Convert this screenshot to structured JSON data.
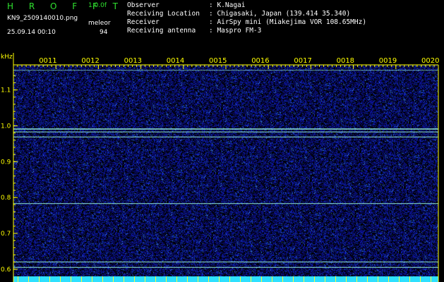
{
  "header": {
    "app_name": "H R O F F T",
    "version": "1.0.0f",
    "file_name": "KN9_2509140010.png",
    "program": "meleor",
    "datetime": "25.09.14 00:10",
    "number": "94"
  },
  "info": [
    {
      "label": "Observer",
      "value": ": K.Nagai"
    },
    {
      "label": "Receiving Location",
      "value": ": Chigasaki, Japan (139.414 35.340)"
    },
    {
      "label": "Receiver",
      "value": ": AirSpy mini (Miakejima VOR 108.65MHz)"
    },
    {
      "label": "Receiving antenna",
      "value": ": Maspro FM-3"
    }
  ],
  "plot": {
    "y_unit": "kHz",
    "y_ticks": [
      "1.1",
      "1.0",
      "0.9",
      "0.8",
      "0.7",
      "0.6"
    ],
    "x_ticks": [
      "0011",
      "0012",
      "0013",
      "0014",
      "0015",
      "0016",
      "0017",
      "0018",
      "0019",
      "0020"
    ],
    "ylim": [
      0.58,
      1.17
    ],
    "colors": {
      "background": "#000000",
      "axis": "#ffff00",
      "noise": "#1e2a9a",
      "line": "#9fffe0",
      "bottom_band": "#2ee0ff"
    }
  }
}
